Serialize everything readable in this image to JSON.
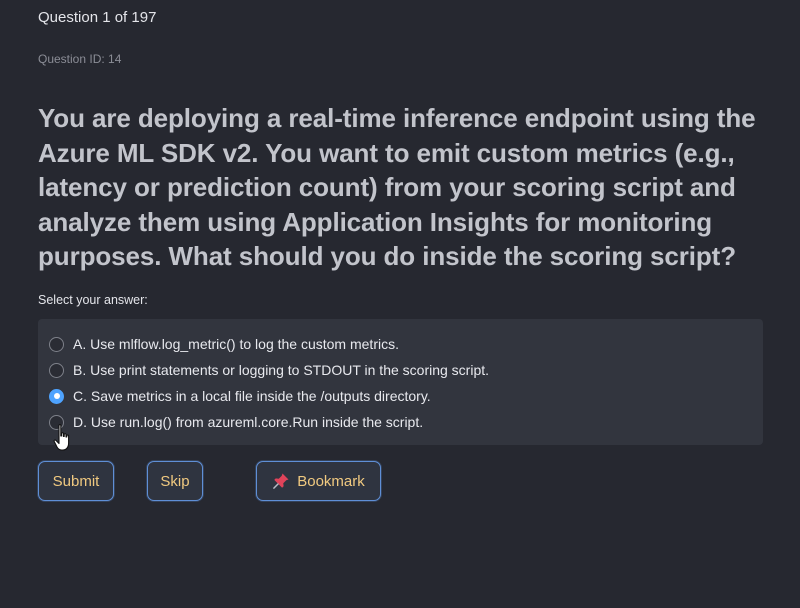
{
  "header": {
    "counter": "Question 1 of 197",
    "question_id": "Question ID: 14"
  },
  "question": {
    "text": "You are deploying a real-time inference endpoint using the Azure ML SDK v2. You want to emit custom metrics (e.g., latency or prediction count) from your scoring script and analyze them using Application Insights for monitoring purposes. What should you do inside the scoring script?"
  },
  "answer": {
    "prompt": "Select your answer:",
    "options": [
      {
        "label": "A. Use mlflow.log_metric() to log the custom metrics.",
        "selected": false
      },
      {
        "label": "B. Use print statements or logging to STDOUT in the scoring script.",
        "selected": false
      },
      {
        "label": "C. Save metrics in a local file inside the /outputs directory.",
        "selected": true
      },
      {
        "label": "D. Use run.log() from azureml.core.Run inside the script.",
        "selected": false
      }
    ]
  },
  "buttons": {
    "submit": "Submit",
    "skip": "Skip",
    "bookmark": "Bookmark",
    "bookmark_icon": "pushpin-icon"
  },
  "colors": {
    "background": "#262830",
    "panel": "#32353e",
    "accent": "#4ea3ff",
    "button_text": "#f0c980",
    "button_border": "#5f8fd6"
  }
}
